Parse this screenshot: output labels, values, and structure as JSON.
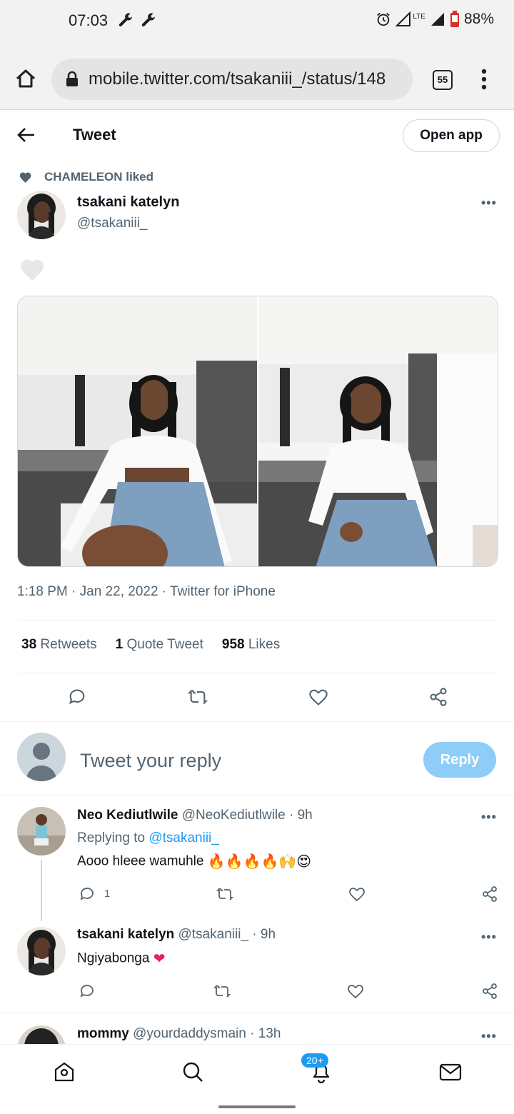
{
  "status_bar": {
    "time": "07:03",
    "battery": "88%",
    "network": "LTE"
  },
  "browser": {
    "url": "mobile.twitter.com/tsakaniii_/status/148",
    "tab_count": "55"
  },
  "header": {
    "title": "Tweet",
    "open_app": "Open app"
  },
  "social_context": "CHAMELEON liked",
  "tweet": {
    "author_name": "tsakani katelyn",
    "author_handle": "@tsakaniii_",
    "timestamp": "1:18 PM · Jan 22, 2022 · Twitter for iPhone",
    "stats": {
      "retweets_count": "38",
      "retweets_label": "Retweets",
      "quotes_count": "1",
      "quotes_label": "Quote Tweet",
      "likes_count": "958",
      "likes_label": "Likes"
    }
  },
  "compose": {
    "placeholder": "Tweet your reply",
    "button": "Reply"
  },
  "replies": [
    {
      "name": "Neo Kediutlwile",
      "handle_time": "@NeoKediutlwile · 9h",
      "replying_prefix": "Replying to ",
      "replying_to": "@tsakaniii_",
      "text": "Aooo hleee wamuhle",
      "emoji": "🔥🔥🔥🔥🙌😍",
      "reply_count": "1"
    },
    {
      "name": "tsakani katelyn",
      "handle_time": "@tsakaniii_ · 9h",
      "text": "Ngiyabonga",
      "emoji": "❤"
    },
    {
      "name": "mommy",
      "handle_time": "@yourdaddysmain · 13h"
    }
  ],
  "nav": {
    "notifications_badge": "20+"
  },
  "colors": {
    "accent": "#1d9bf0",
    "reply_button_disabled": "#8ecdf7",
    "secondary_text": "#536471"
  }
}
